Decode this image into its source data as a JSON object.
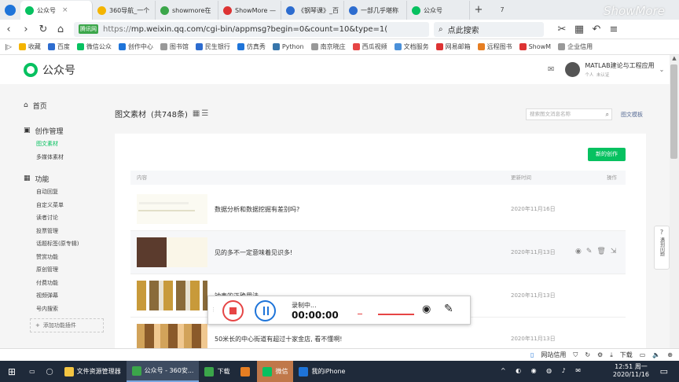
{
  "browser": {
    "tabs": [
      {
        "label": "公众号",
        "active": true,
        "color": "#07c160"
      },
      {
        "label": "360导航_一个",
        "color": "#f4b400"
      },
      {
        "label": "showmore在",
        "color": "#3ba64a"
      },
      {
        "label": "ShowMore —",
        "color": "#d33"
      },
      {
        "label": "《钢琴课》_百",
        "color": "#2d6ccf"
      },
      {
        "label": "一部几乎堪称",
        "color": "#2d6ccf"
      },
      {
        "label": "公众号",
        "color": "#07c160"
      }
    ],
    "new_tab_symbol": "+",
    "tab_count": "7",
    "url_tag": "腾讯网",
    "url_scheme": "https://",
    "url_rest": "mp.weixin.qq.com/cgi-bin/appmsg?begin=0&count=10&type=1(",
    "search_placeholder": "点此搜索",
    "bookmarks": [
      {
        "label": "收藏",
        "color": "#f4b400"
      },
      {
        "label": "百度",
        "color": "#2d6ccf"
      },
      {
        "label": "微信公众",
        "color": "#07c160"
      },
      {
        "label": "创作中心",
        "color": "#1e74d9"
      },
      {
        "label": "图书馆",
        "color": "#999"
      },
      {
        "label": "民生银行",
        "color": "#2d6ccf"
      },
      {
        "label": "仿真秀",
        "color": "#1e74d9"
      },
      {
        "label": "Python",
        "color": "#3776ab"
      },
      {
        "label": "南京晓庄",
        "color": "#999"
      },
      {
        "label": "西瓜视频",
        "color": "#e64545"
      },
      {
        "label": "文档服务",
        "color": "#4a90d9"
      },
      {
        "label": "网易邮箱",
        "color": "#d33"
      },
      {
        "label": "远程图书",
        "color": "#e67e22"
      },
      {
        "label": "ShowM",
        "color": "#d33"
      },
      {
        "label": "企业信用",
        "color": "#999"
      }
    ]
  },
  "wx": {
    "brand": "公众号",
    "account_name": "MATLAB建论与工程应用",
    "account_sub1": "个人",
    "account_sub2": "未认证"
  },
  "sidebar": {
    "home": "首页",
    "creation": "创作管理",
    "creation_items": [
      "图文素材",
      "多媒体素材"
    ],
    "function": "功能",
    "function_items": [
      "自动回复",
      "自定义菜单",
      "读者讨论",
      "投票管理",
      "话题标签(原专辑)",
      "赞赏功能",
      "原创管理",
      "付费功能",
      "视频弹幕",
      "号内搜索"
    ],
    "add_plugin": "添加功能插件"
  },
  "main": {
    "title": "图文素材",
    "count": "(共748条)",
    "search_placeholder": "搜索图文消息名称",
    "template_link": "图文模板",
    "new_button": "新的创作",
    "col_content": "内容",
    "col_time": "更新时间",
    "col_ops": "操作",
    "rows": [
      {
        "title": "数据分析和数据挖掘有差别吗?",
        "date": "2020年11月16日"
      },
      {
        "title": "见的多不一定意味着见识多!",
        "date": "2020年11月13日"
      },
      {
        "title": "钟表的正确用法",
        "date": "2020年11月13日"
      },
      {
        "title": "50米长的中心街道有超过十家金店, 看不懂啊!",
        "date": "2020年11月13日"
      }
    ]
  },
  "recorder": {
    "status": "录制中...",
    "time": "00:00:00"
  },
  "statusbar": {
    "site_label": "网站信用",
    "download": "下载"
  },
  "feedback": "遇到问题",
  "taskbar": {
    "items": [
      {
        "label": "文件资源管理器",
        "color": "#f4c542"
      },
      {
        "label": "公众号 - 360安...",
        "color": "#3ba64a",
        "active": true
      },
      {
        "label": "下载",
        "color": "#3ba64a"
      },
      {
        "label": "",
        "color": "#e67e22"
      },
      {
        "label": "微信",
        "color": "#07c160"
      },
      {
        "label": "我的iPhone",
        "color": "#1e74d9"
      }
    ],
    "time": "12:51 周一",
    "date": "2020/11/16"
  },
  "watermark": "ShowMore"
}
